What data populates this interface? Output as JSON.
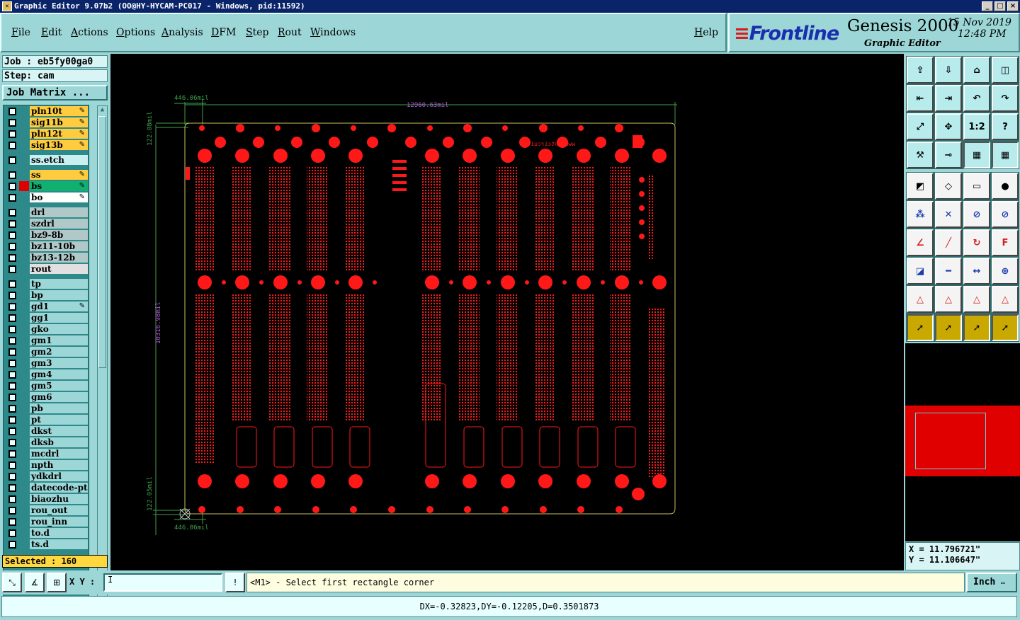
{
  "window": {
    "title": "Graphic Editor 9.07b2 (OO@HY-HYCAM-PC017 - Windows, pid:11592)"
  },
  "menu": [
    "File",
    "Edit",
    "Actions",
    "Options",
    "Analysis",
    "DFM",
    "Step",
    "Rout",
    "Windows"
  ],
  "help": "Help",
  "brand": {
    "logo": "Frontline",
    "product": "Genesis 2000",
    "subtitle": "Graphic Editor",
    "date": "15 Nov 2019",
    "time": "12:48 PM"
  },
  "job": {
    "job": "Job : eb5fy00ga0",
    "step": "Step: cam",
    "matrix": "Job Matrix ..."
  },
  "layers": [
    {
      "name": "pln10t",
      "color": "#ffcc40",
      "edit": true
    },
    {
      "name": "sig11b",
      "color": "#ffcc40",
      "edit": true
    },
    {
      "name": "pln12t",
      "color": "#ffcc40",
      "edit": true
    },
    {
      "name": "sig13b",
      "color": "#ffcc40",
      "edit": true
    },
    {
      "name": "ss.etch",
      "color": "#c8f0f0",
      "edit": false,
      "gap": true
    },
    {
      "name": "ss",
      "color": "#ffcc40",
      "edit": true,
      "gap": true
    },
    {
      "name": "bs",
      "color": "#10b070",
      "edit": true,
      "active": true
    },
    {
      "name": "bo",
      "color": "#ffffff",
      "edit": true
    },
    {
      "name": "drl",
      "color": "#b0c8c8",
      "edit": false,
      "gap": true
    },
    {
      "name": "szdrl",
      "color": "#b0c8c8",
      "edit": false
    },
    {
      "name": "bz9-8b",
      "color": "#b0c8c8",
      "edit": false
    },
    {
      "name": "bz11-10b",
      "color": "#b0c8c8",
      "edit": false
    },
    {
      "name": "bz13-12b",
      "color": "#b0c8c8",
      "edit": false
    },
    {
      "name": "rout",
      "color": "#e0e0e0",
      "edit": false
    },
    {
      "name": "tp",
      "color": "#9cd6d6",
      "edit": false,
      "gap": true
    },
    {
      "name": "bp",
      "color": "#9cd6d6",
      "edit": false
    },
    {
      "name": "gd1",
      "color": "#9cd6d6",
      "edit": true
    },
    {
      "name": "gg1",
      "color": "#9cd6d6",
      "edit": false
    },
    {
      "name": "gko",
      "color": "#9cd6d6",
      "edit": false
    },
    {
      "name": "gm1",
      "color": "#9cd6d6",
      "edit": false
    },
    {
      "name": "gm2",
      "color": "#9cd6d6",
      "edit": false
    },
    {
      "name": "gm3",
      "color": "#9cd6d6",
      "edit": false
    },
    {
      "name": "gm4",
      "color": "#9cd6d6",
      "edit": false
    },
    {
      "name": "gm5",
      "color": "#9cd6d6",
      "edit": false
    },
    {
      "name": "gm6",
      "color": "#9cd6d6",
      "edit": false
    },
    {
      "name": "pb",
      "color": "#9cd6d6",
      "edit": false
    },
    {
      "name": "pt",
      "color": "#9cd6d6",
      "edit": false
    },
    {
      "name": "dkst",
      "color": "#9cd6d6",
      "edit": false
    },
    {
      "name": "dksb",
      "color": "#9cd6d6",
      "edit": false
    },
    {
      "name": "mcdrl",
      "color": "#9cd6d6",
      "edit": false
    },
    {
      "name": "npth",
      "color": "#9cd6d6",
      "edit": false
    },
    {
      "name": "ydkdrl",
      "color": "#9cd6d6",
      "edit": false
    },
    {
      "name": "datecode-pt",
      "color": "#9cd6d6",
      "edit": false
    },
    {
      "name": "biaozhu",
      "color": "#9cd6d6",
      "edit": false
    },
    {
      "name": "rou_out",
      "color": "#9cd6d6",
      "edit": false
    },
    {
      "name": "rou_inn",
      "color": "#9cd6d6",
      "edit": false
    },
    {
      "name": "to.d",
      "color": "#9cd6d6",
      "edit": false
    },
    {
      "name": "ts.d",
      "color": "#9cd6d6",
      "edit": false
    }
  ],
  "selected": "Selected : 160",
  "dimensions": {
    "top": "12960.63mil",
    "topleft": "446.06mil",
    "bottomleft": "446.06mil",
    "left": "10316.98mil",
    "lefttop": "122.08mil",
    "leftbottom": "122.05mil"
  },
  "board_text": "www.whtcircuit",
  "tools": [
    "home-up",
    "page-down",
    "home",
    "split-view",
    "pan-left",
    "pan-right",
    "undo-view",
    "redo-view",
    "fit-screen",
    "zoom-center",
    "zoom-1to2",
    "help-q",
    "measure",
    "snap",
    "layer-on",
    "layer-off",
    "add-pad",
    "add-line",
    "ruler",
    "add-circle",
    "connect-nodes",
    "delete-node",
    "add-node",
    "move-node",
    "angle",
    "slope",
    "rotate",
    "frontline-f",
    "select-pad",
    "line-cut",
    "dimension",
    "shape",
    "arc-a",
    "arc-b",
    "arc-c",
    "arc-d",
    "pointer",
    "pointer-box",
    "pointer-select",
    "pointer-net"
  ],
  "active_tools": [
    19,
    20,
    39,
    36,
    37,
    38
  ],
  "coords": {
    "x": "X = 11.796721\"",
    "y": "Y = 11.106647\""
  },
  "xy_label": "X Y :",
  "xy_value": "I",
  "prompt": "<M1> - Select first rectangle corner",
  "unit": "Inch",
  "status": "DX=-0.32823,DY=-0.12205,D=0.3501873"
}
